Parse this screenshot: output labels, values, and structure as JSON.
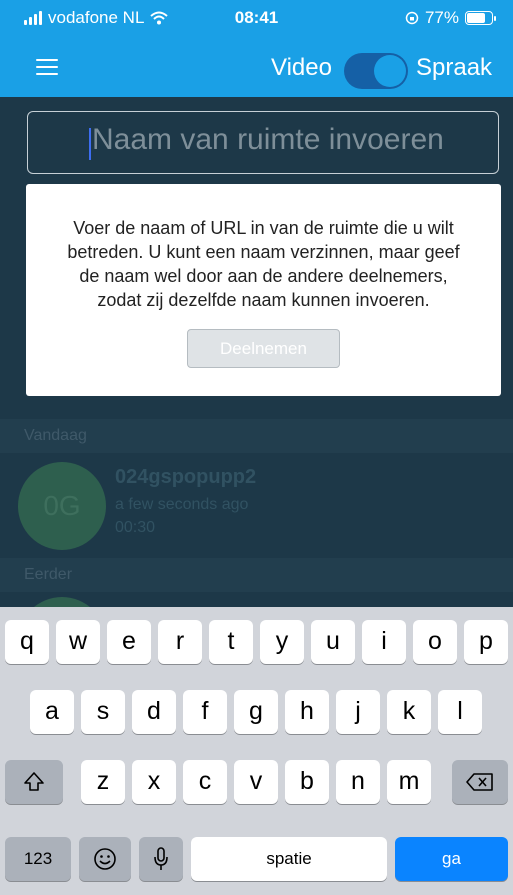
{
  "status_bar": {
    "carrier": "vodafone NL",
    "time": "08:41",
    "battery": "77%",
    "battery_level": 0.77,
    "icons": [
      "signal-bars-icon",
      "wifi-icon",
      "rotation-lock-icon",
      "battery-icon"
    ]
  },
  "app_bar": {
    "menu_icon": "hamburger-menu-icon",
    "mode_left": "Video",
    "mode_right": "Spraak"
  },
  "room_input": {
    "placeholder": "Naam van ruimte invoeren",
    "value": ""
  },
  "help_card": {
    "text": "Voer de naam of URL in van de ruimte die u wilt\nbetreden. U kunt een naam verzinnen, maar geef\nde naam wel door aan de andere deelnemers,\nzodat zij dezelfde naam kunnen invoeren.",
    "join_label": "Deelnemen"
  },
  "recent": {
    "today_header": "Vandaag",
    "earlier_header": "Eerder",
    "items": [
      {
        "avatar": "0G",
        "title": "024gspopupp2",
        "when": "a few seconds ago",
        "duration": "00:30"
      }
    ]
  },
  "keyboard": {
    "row1": [
      "q",
      "w",
      "e",
      "r",
      "t",
      "y",
      "u",
      "i",
      "o",
      "p"
    ],
    "row2": [
      "a",
      "s",
      "d",
      "f",
      "g",
      "h",
      "j",
      "k",
      "l"
    ],
    "row3": [
      "z",
      "x",
      "c",
      "v",
      "b",
      "n",
      "m"
    ],
    "numbers_label": "123",
    "space_label": "spatie",
    "go_label": "ga",
    "icons": [
      "shift-icon",
      "backspace-icon",
      "emoji-icon",
      "microphone-icon"
    ],
    "colors": {
      "go": "#0a84ff",
      "background": "#d1d4da"
    }
  },
  "colors": {
    "app_bar": "#1aa0e6",
    "background": "#1d3848",
    "toggle_track": "#1560a6"
  }
}
